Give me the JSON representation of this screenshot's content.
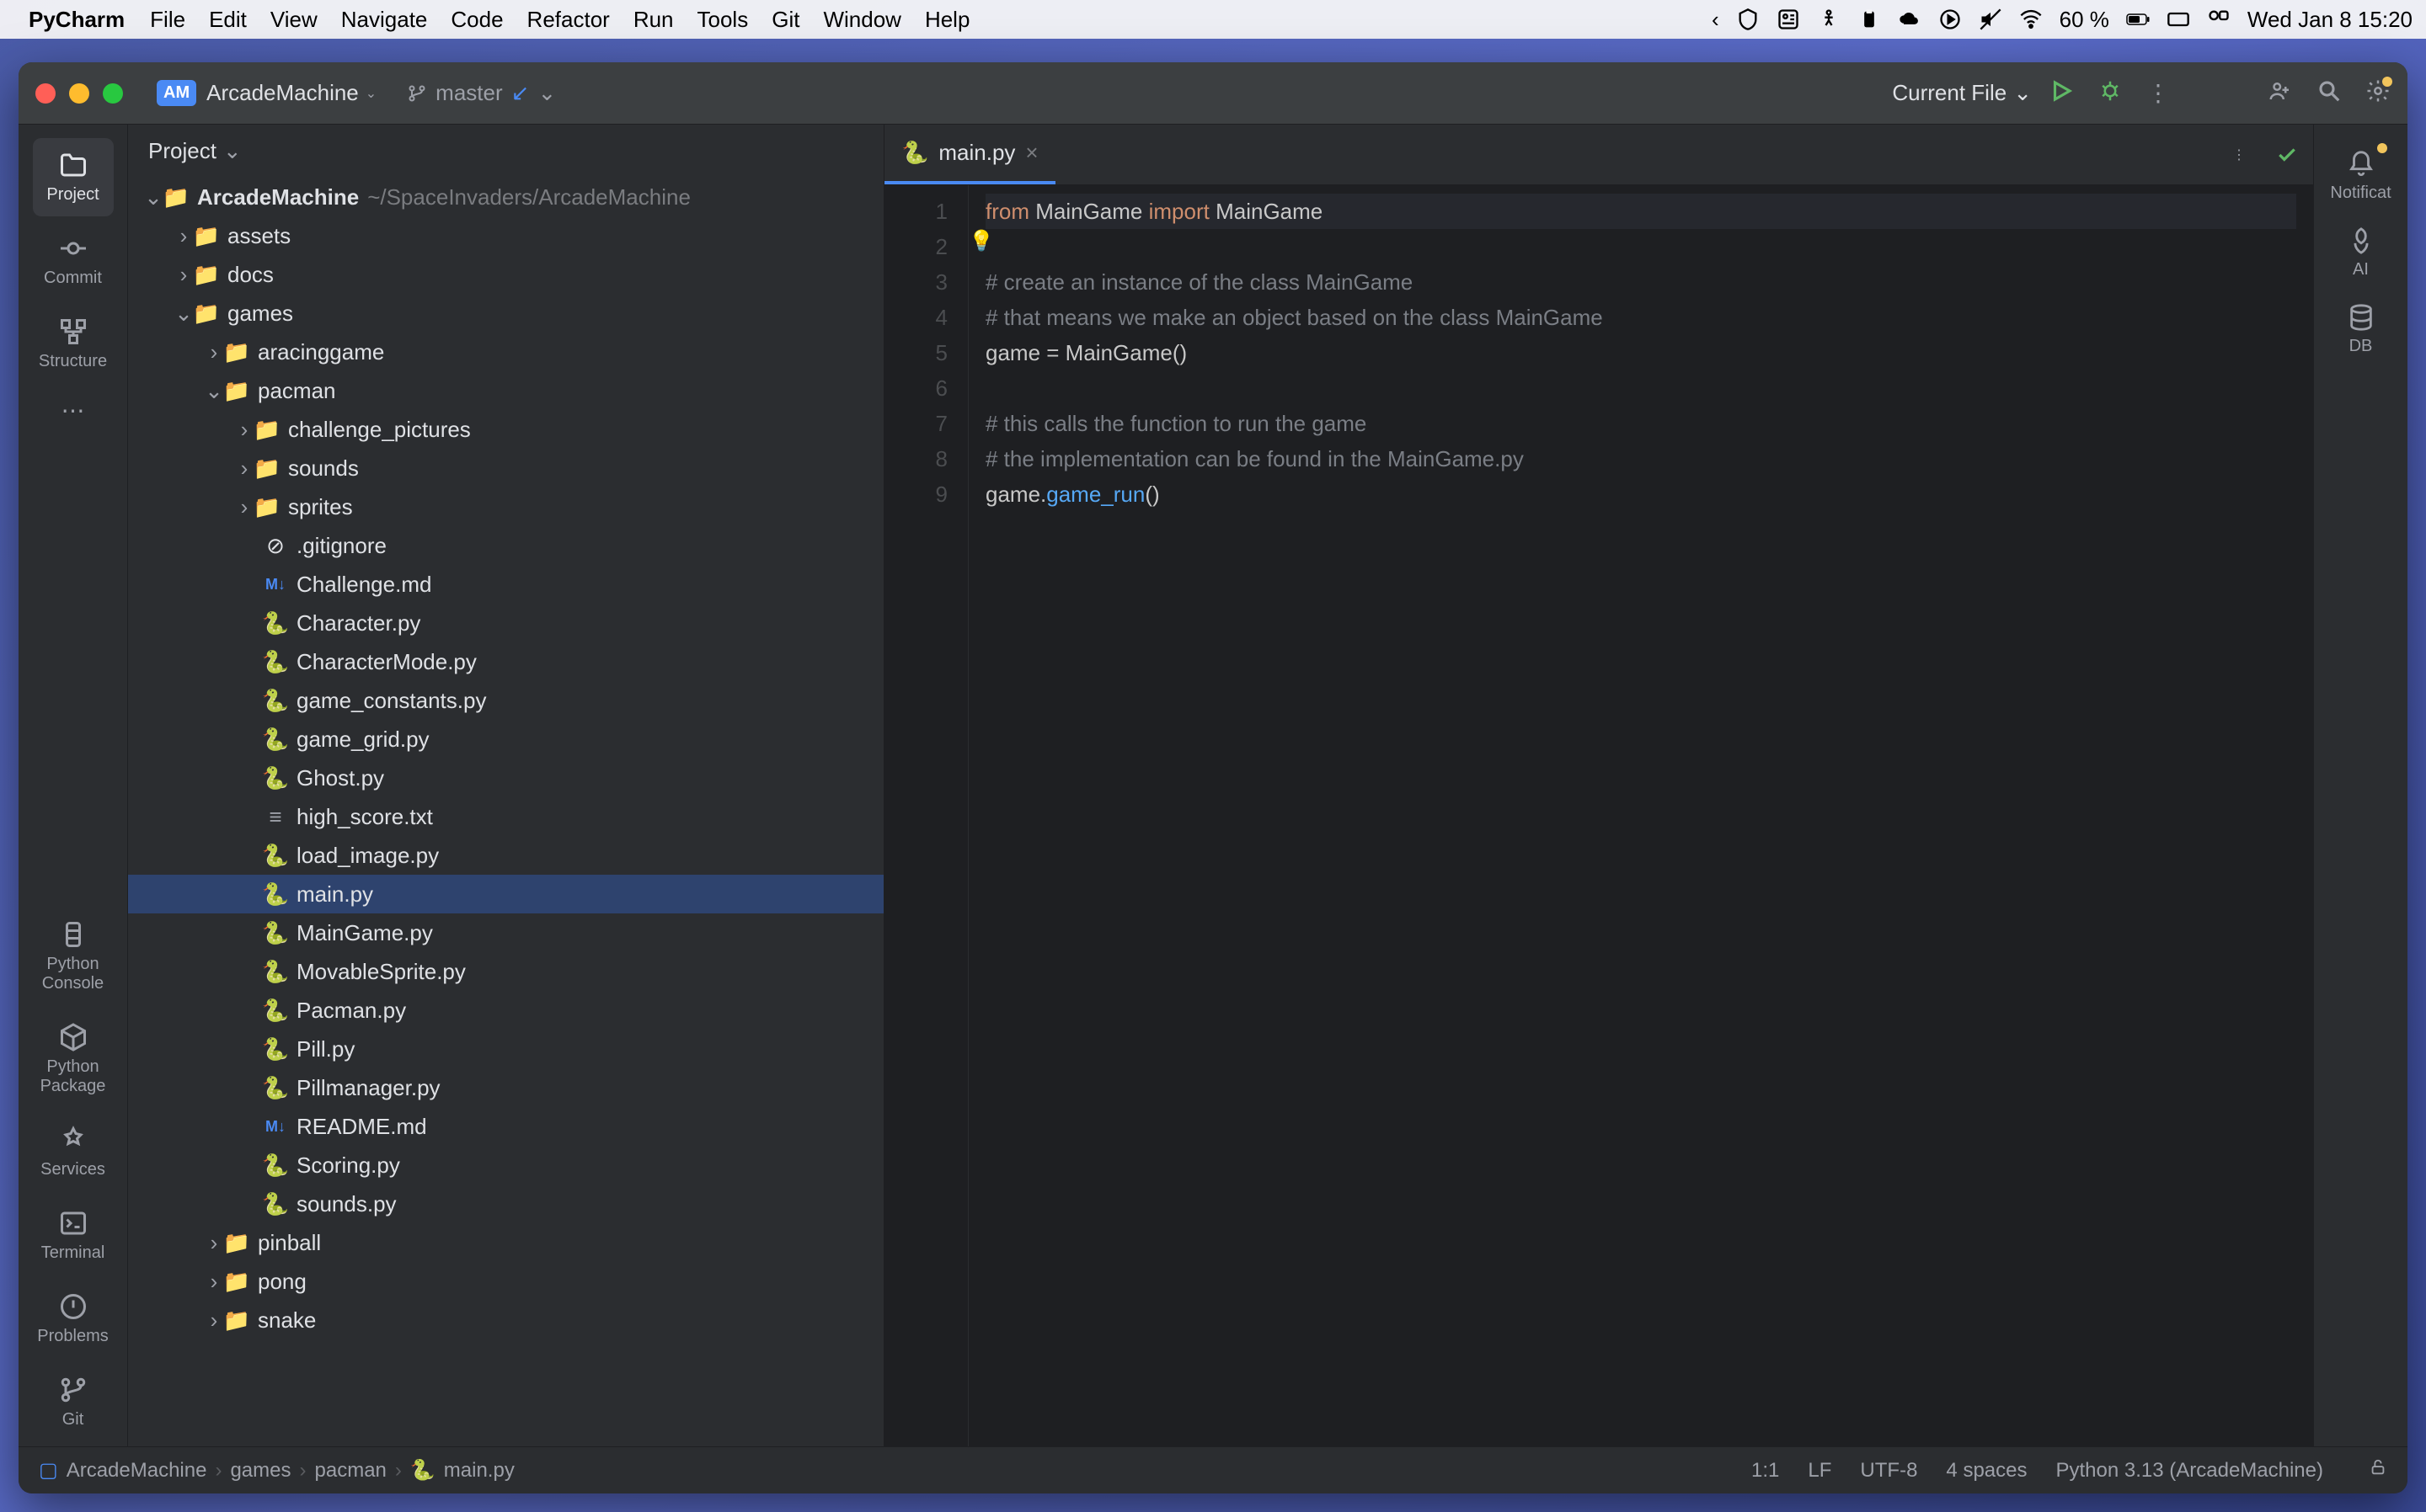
{
  "mac_menu": {
    "app": "PyCharm",
    "items": [
      "File",
      "Edit",
      "View",
      "Navigate",
      "Code",
      "Refactor",
      "Run",
      "Tools",
      "Git",
      "Window",
      "Help"
    ],
    "battery": "60 %",
    "datetime": "Wed Jan 8  15:20"
  },
  "titlebar": {
    "badge": "AM",
    "project": "ArcadeMachine",
    "branch": "master",
    "run_config": "Current File"
  },
  "left_tools": {
    "project": "Project",
    "commit": "Commit",
    "structure": "Structure",
    "python_console": "Python\nConsole",
    "python_packages": "Python\nPackage",
    "services": "Services",
    "terminal": "Terminal",
    "problems": "Problems",
    "git": "Git"
  },
  "right_tools": {
    "notifications": "Notificat",
    "ai": "AI",
    "db": "DB"
  },
  "panel": {
    "title": "Project"
  },
  "tree": {
    "root_name": "ArcadeMachine",
    "root_path": "~/SpaceInvaders/ArcadeMachine",
    "assets": "assets",
    "docs": "docs",
    "games": "games",
    "aracinggame": "aracinggame",
    "pacman": "pacman",
    "challenge_pictures": "challenge_pictures",
    "sounds": "sounds",
    "sprites": "sprites",
    "gitignore": ".gitignore",
    "challenge_md": "Challenge.md",
    "character": "Character.py",
    "character_mode": "CharacterMode.py",
    "game_constants": "game_constants.py",
    "game_grid": "game_grid.py",
    "ghost": "Ghost.py",
    "high_score": "high_score.txt",
    "load_image": "load_image.py",
    "main": "main.py",
    "maingame": "MainGame.py",
    "movable_sprite": "MovableSprite.py",
    "pacman_py": "Pacman.py",
    "pill": "Pill.py",
    "pillmanager": "Pillmanager.py",
    "readme": "README.md",
    "scoring": "Scoring.py",
    "sounds_py": "sounds.py",
    "pinball": "pinball",
    "pong": "pong",
    "snake": "snake"
  },
  "editor_tab": {
    "label": "main.py"
  },
  "code": {
    "l1_from": "from",
    "l1_mod": " MainGame ",
    "l1_import": "import",
    "l1_cls": " MainGame",
    "l3": "# create an instance of the class MainGame",
    "l4": "# that means we make an object based on the class MainGame",
    "l5a": "game = ",
    "l5b": "MainGame",
    "l5c": "()",
    "l7": "# this calls the function to run the game",
    "l8": "# the implementation can be found in the MainGame.py",
    "l9a": "game.",
    "l9b": "game_run",
    "l9c": "()"
  },
  "breadcrumb": {
    "p1": "ArcadeMachine",
    "p2": "games",
    "p3": "pacman",
    "p4": "main.py"
  },
  "status": {
    "pos": "1:1",
    "line_sep": "LF",
    "encoding": "UTF-8",
    "indent": "4 spaces",
    "interpreter": "Python 3.13 (ArcadeMachine)"
  }
}
